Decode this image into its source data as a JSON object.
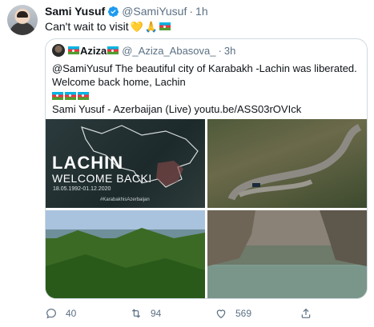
{
  "tweet": {
    "display_name": "Sami Yusuf",
    "handle": "@SamiYusuf",
    "separator": "·",
    "time": "1h",
    "text": "Can't wait to visit",
    "emojis": [
      "💛",
      "🙏"
    ]
  },
  "quoted_tweet": {
    "display_name": "Aziza",
    "handle": "@_Aziza_Abasova_",
    "separator": "·",
    "time": "3h",
    "line1": "@SamiYusuf The  beautiful city of Karabakh -Lachin was liberated.",
    "line2": "Welcome back home, Lachin",
    "line3": "Sami Yusuf - Azerbaijan (Live) youtu.be/ASS03rOVIck",
    "image1": {
      "title": "LACHIN",
      "subtitle": "WELCOME BACK!",
      "dates": "18.05.1992-01.12.2020",
      "hashtag": "#KarabakhisAzerbaijan"
    }
  },
  "actions": {
    "reply_count": "40",
    "retweet_count": "94",
    "like_count": "569"
  },
  "colors": {
    "verified": "#1d9bf0",
    "muted_text": "#5b7083",
    "border": "#cfd9de"
  }
}
